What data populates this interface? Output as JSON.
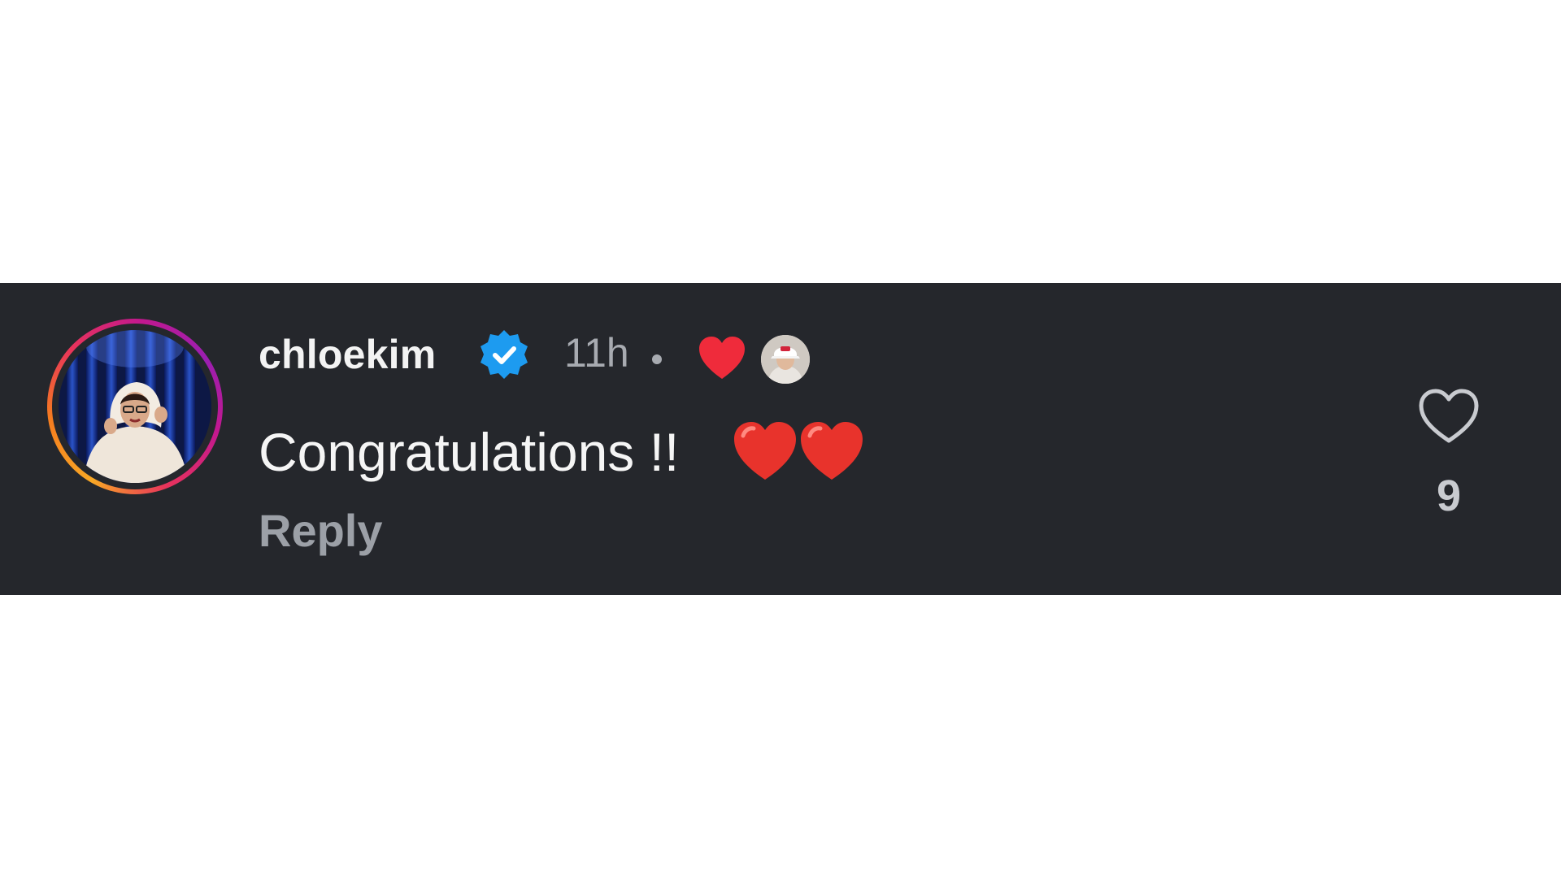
{
  "comment": {
    "username": "chloekim",
    "verified": true,
    "time": "11h",
    "text": "Congratulations !!",
    "emoji_hearts": 2,
    "reply_label": "Reply",
    "likes": "9",
    "liked_by_creator": true
  },
  "icons": {
    "verified": "verified-badge-icon",
    "creator_heart": "heart-icon",
    "like": "heart-outline-icon"
  },
  "colors": {
    "background": "#25272c",
    "username": "#f3f3f3",
    "muted": "#a8abb1",
    "verified": "#1d9bf0",
    "heart": "#ef2b3b"
  }
}
